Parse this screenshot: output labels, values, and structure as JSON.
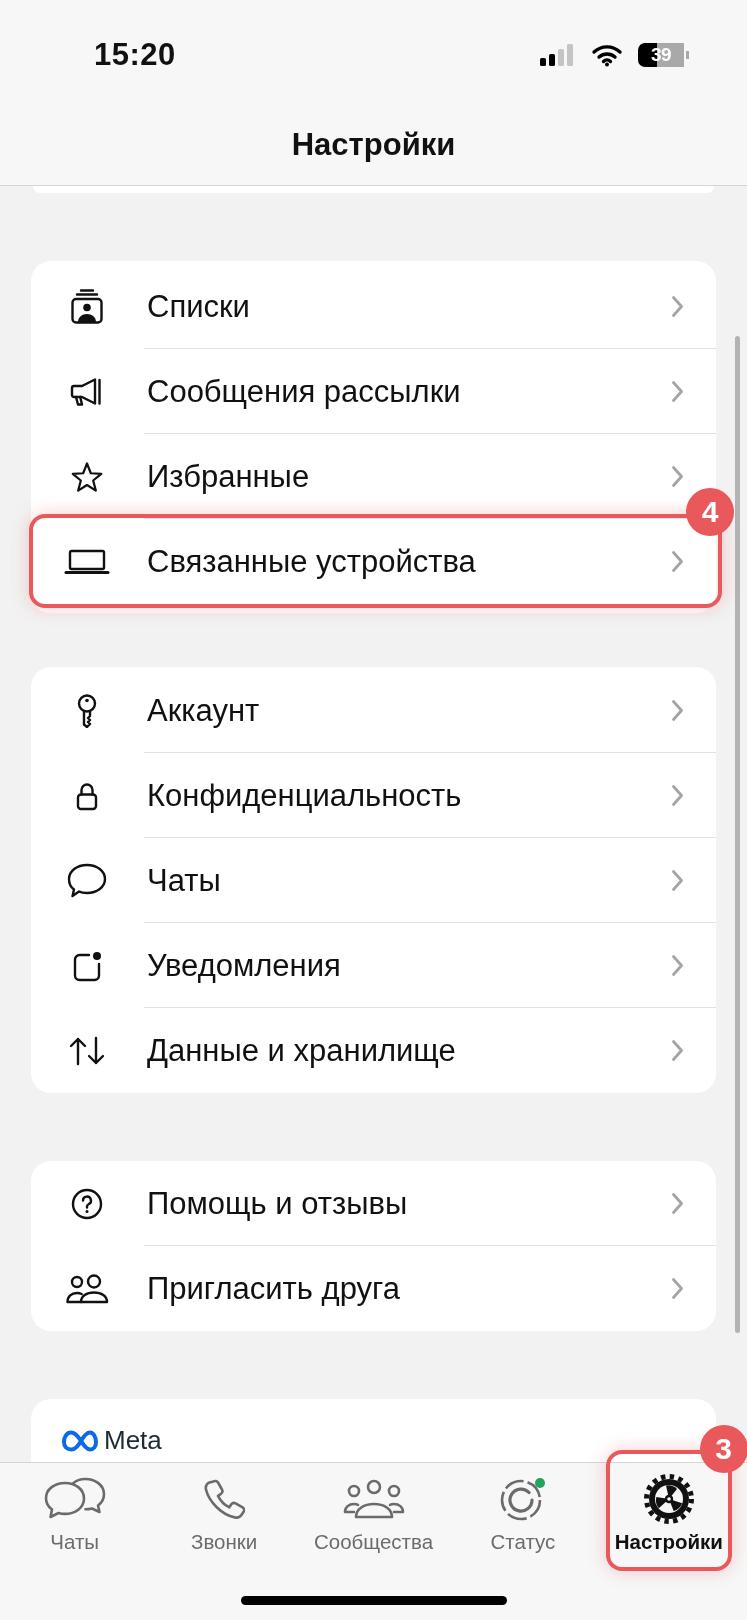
{
  "status_bar": {
    "time": "15:20",
    "battery": "39"
  },
  "header": {
    "title": "Настройки"
  },
  "groups": [
    {
      "items": [
        {
          "label": "Списки",
          "highlighted": false
        },
        {
          "label": "Сообщения рассылки",
          "highlighted": false
        },
        {
          "label": "Избранные",
          "highlighted": false
        },
        {
          "label": "Связанные устройства",
          "highlighted": true,
          "callout": "4"
        }
      ]
    },
    {
      "items": [
        {
          "label": "Аккаунт",
          "highlighted": false
        },
        {
          "label": "Конфиденциальность",
          "highlighted": false
        },
        {
          "label": "Чаты",
          "highlighted": false
        },
        {
          "label": "Уведомления",
          "highlighted": false
        },
        {
          "label": "Данные и хранилище",
          "highlighted": false
        }
      ]
    },
    {
      "items": [
        {
          "label": "Помощь и отзывы",
          "highlighted": false
        },
        {
          "label": "Пригласить друга",
          "highlighted": false
        }
      ]
    }
  ],
  "footer_card": {
    "logo_text": "Meta"
  },
  "tab_bar": {
    "tabs": [
      {
        "label": "Чаты",
        "selected": false,
        "highlighted": false
      },
      {
        "label": "Звонки",
        "selected": false,
        "highlighted": false
      },
      {
        "label": "Сообщества",
        "selected": false,
        "highlighted": false
      },
      {
        "label": "Статус",
        "selected": false,
        "highlighted": false
      },
      {
        "label": "Настройки",
        "selected": true,
        "highlighted": true,
        "callout": "3"
      }
    ]
  }
}
